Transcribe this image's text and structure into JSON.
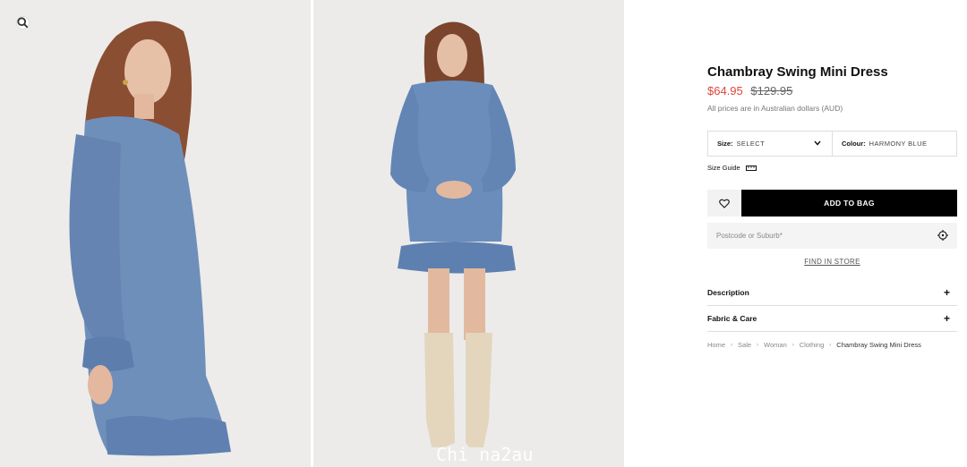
{
  "gallery": {
    "zoom_icon": "magnifier-icon",
    "watermark": "Chi na2au"
  },
  "product": {
    "title": "Chambray Swing Mini Dress",
    "price_sale": "$64.95",
    "price_original": "$129.95",
    "currency_note": "All prices are in Australian dollars (AUD)"
  },
  "selectors": {
    "size_label": "Size:",
    "size_value": "SELECT",
    "colour_label": "Colour:",
    "colour_value": "HARMONY BLUE"
  },
  "size_guide": {
    "label": "Size Guide",
    "icon": "ruler-icon"
  },
  "actions": {
    "wishlist_icon": "heart-icon",
    "add_to_bag": "ADD TO BAG"
  },
  "store": {
    "postcode_placeholder": "Postcode or Suburb*",
    "locate_icon": "crosshair-icon",
    "find_in_store": "FIND IN STORE"
  },
  "accordions": [
    {
      "label": "Description",
      "icon": "plus-icon"
    },
    {
      "label": "Fabric & Care",
      "icon": "plus-icon"
    }
  ],
  "breadcrumb": [
    "Home",
    "Sale",
    "Woman",
    "Clothing",
    "Chambray Swing Mini Dress"
  ],
  "colors": {
    "sale_price": "#e0453a",
    "denim": "#6d8fbd",
    "background": "#eeeeec",
    "button": "#000000"
  }
}
